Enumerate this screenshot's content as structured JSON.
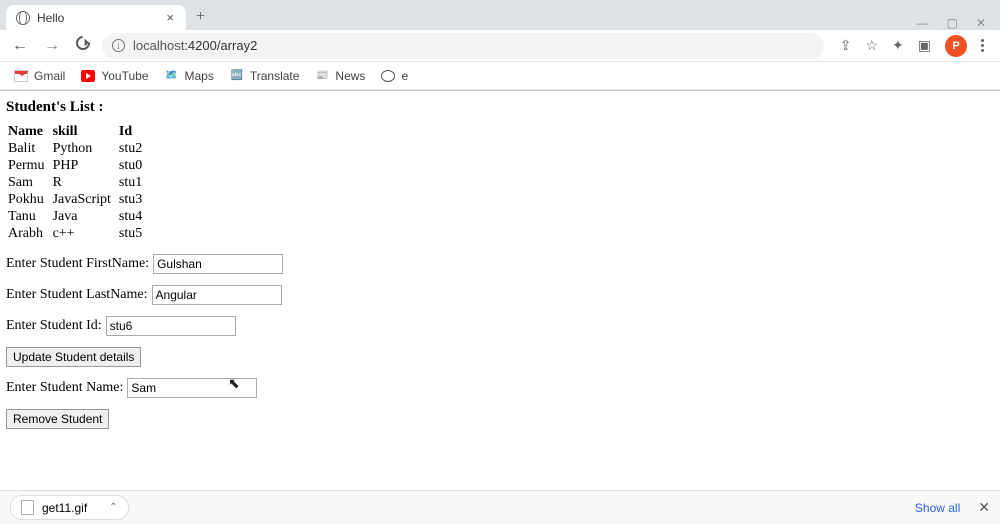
{
  "tab": {
    "title": "Hello"
  },
  "url": {
    "host": "localhost",
    "port_path": ":4200/array2"
  },
  "bookmarks": [
    {
      "label": "Gmail"
    },
    {
      "label": "YouTube"
    },
    {
      "label": "Maps"
    },
    {
      "label": "Translate"
    },
    {
      "label": "News"
    },
    {
      "label": "e"
    }
  ],
  "avatar_initial": "P",
  "page": {
    "heading": "Student's List :",
    "cols": {
      "name": "Name",
      "skill": "skill",
      "id": "Id"
    },
    "students": [
      {
        "name": "Balit",
        "skill": "Python",
        "id": "stu2"
      },
      {
        "name": "Permu",
        "skill": "PHP",
        "id": "stu0"
      },
      {
        "name": "Sam",
        "skill": "R",
        "id": "stu1"
      },
      {
        "name": "Pokhu",
        "skill": "JavaScript",
        "id": "stu3"
      },
      {
        "name": "Tanu",
        "skill": "Java",
        "id": "stu4"
      },
      {
        "name": "Arabh",
        "skill": "c++",
        "id": "stu5"
      }
    ],
    "form": {
      "firstname_label": "Enter Student FirstName:",
      "firstname_value": "Gulshan",
      "lastname_label": "Enter Student LastName:",
      "lastname_value": "Angular",
      "id_label": "Enter Student Id:",
      "id_value": "stu6",
      "update_btn": "Update Student details",
      "remove_name_label": "Enter Student Name:",
      "remove_name_value": "Sam",
      "remove_btn": "Remove Student"
    }
  },
  "downloads": {
    "item": "get11.gif",
    "showall": "Show all"
  }
}
